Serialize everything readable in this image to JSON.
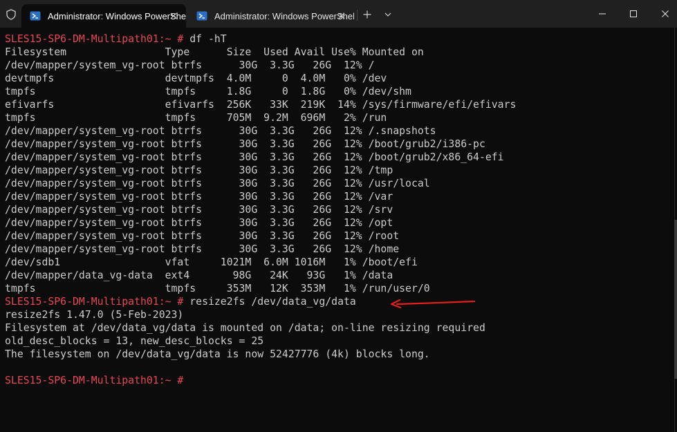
{
  "window": {
    "tabs": [
      {
        "label": "Administrator: Windows PowerShell",
        "active": true
      },
      {
        "label": "Administrator: Windows PowerShell",
        "active": false
      }
    ],
    "icons": {
      "shield": "shield-icon",
      "tab": "powershell-icon",
      "close": "close-icon",
      "new_tab": "plus-icon",
      "dropdown": "chevron-down-icon",
      "minimize": "minimize-icon",
      "maximize": "maximize-icon",
      "close_window": "close-icon"
    }
  },
  "colors": {
    "background": "#0c0c0c",
    "foreground": "#cccccc",
    "prompt": "#e74856",
    "titlebar": "#202020",
    "annotation_arrow": "#e0201e"
  },
  "terminal": {
    "lines": [
      {
        "prompt": "SLES15-SP6-DM-Multipath01:~ #",
        "cmd": " df -hT"
      },
      {
        "text": "Filesystem                Type      Size  Used Avail Use% Mounted on"
      },
      {
        "text": "/dev/mapper/system_vg-root btrfs      30G  3.3G   26G  12% /"
      },
      {
        "text": "devtmpfs                  devtmpfs  4.0M     0  4.0M   0% /dev"
      },
      {
        "text": "tmpfs                     tmpfs     1.8G     0  1.8G   0% /dev/shm"
      },
      {
        "text": "efivarfs                  efivarfs  256K   33K  219K  14% /sys/firmware/efi/efivars"
      },
      {
        "text": "tmpfs                     tmpfs     705M  9.2M  696M   2% /run"
      },
      {
        "text": "/dev/mapper/system_vg-root btrfs      30G  3.3G   26G  12% /.snapshots"
      },
      {
        "text": "/dev/mapper/system_vg-root btrfs      30G  3.3G   26G  12% /boot/grub2/i386-pc"
      },
      {
        "text": "/dev/mapper/system_vg-root btrfs      30G  3.3G   26G  12% /boot/grub2/x86_64-efi"
      },
      {
        "text": "/dev/mapper/system_vg-root btrfs      30G  3.3G   26G  12% /tmp"
      },
      {
        "text": "/dev/mapper/system_vg-root btrfs      30G  3.3G   26G  12% /usr/local"
      },
      {
        "text": "/dev/mapper/system_vg-root btrfs      30G  3.3G   26G  12% /var"
      },
      {
        "text": "/dev/mapper/system_vg-root btrfs      30G  3.3G   26G  12% /srv"
      },
      {
        "text": "/dev/mapper/system_vg-root btrfs      30G  3.3G   26G  12% /opt"
      },
      {
        "text": "/dev/mapper/system_vg-root btrfs      30G  3.3G   26G  12% /root"
      },
      {
        "text": "/dev/mapper/system_vg-root btrfs      30G  3.3G   26G  12% /home"
      },
      {
        "text": "/dev/sdb1                 vfat     1021M  6.0M 1016M   1% /boot/efi"
      },
      {
        "text": "/dev/mapper/data_vg-data  ext4       98G   24K   93G   1% /data"
      },
      {
        "text": "tmpfs                     tmpfs     353M   12K  353M   1% /run/user/0"
      },
      {
        "prompt": "SLES15-SP6-DM-Multipath01:~ #",
        "cmd": " resize2fs /dev/data_vg/data"
      },
      {
        "text": "resize2fs 1.47.0 (5-Feb-2023)"
      },
      {
        "text": "Filesystem at /dev/data_vg/data is mounted on /data; on-line resizing required"
      },
      {
        "text": "old_desc_blocks = 13, new_desc_blocks = 25"
      },
      {
        "text": "The filesystem on /dev/data_vg/data is now 52427776 (4k) blocks long."
      },
      {
        "text": ""
      },
      {
        "prompt": "SLES15-SP6-DM-Multipath01:~ #",
        "cmd": ""
      }
    ]
  }
}
